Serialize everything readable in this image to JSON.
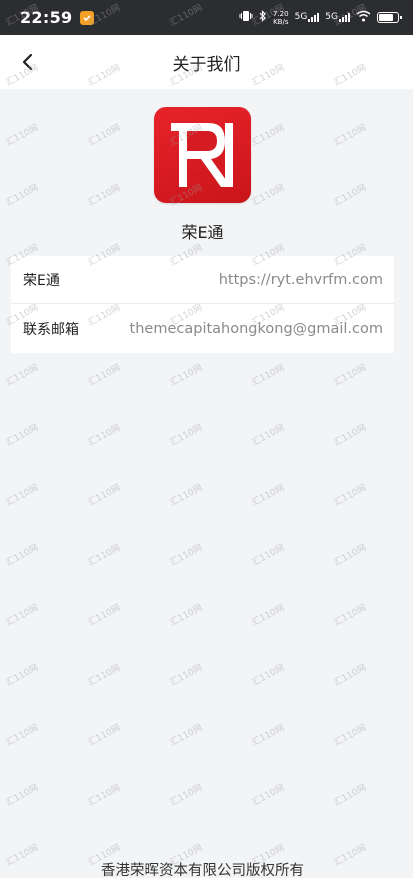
{
  "status_bar": {
    "time": "22:59",
    "net_speed_value": "7.20",
    "net_speed_unit": "KB/s",
    "sim1_label": "5G",
    "sim2_label": "5G",
    "icons": [
      "vibrate-icon",
      "bluetooth-icon",
      "signal-icon",
      "wifi-icon",
      "battery-icon"
    ]
  },
  "nav": {
    "title": "关于我们",
    "back_icon": "chevron-left-icon"
  },
  "app": {
    "name": "荣E通",
    "logo_color": "#e8232a"
  },
  "info": {
    "rows": [
      {
        "label": "荣E通",
        "value": "https://ryt.ehvrfm.com"
      },
      {
        "label": "联系邮箱",
        "value": "themecapitahongkong@gmail.com"
      }
    ]
  },
  "footer": {
    "copyright": "香港荣晖资本有限公司版权所有"
  },
  "watermark": {
    "text": "汇110网"
  }
}
